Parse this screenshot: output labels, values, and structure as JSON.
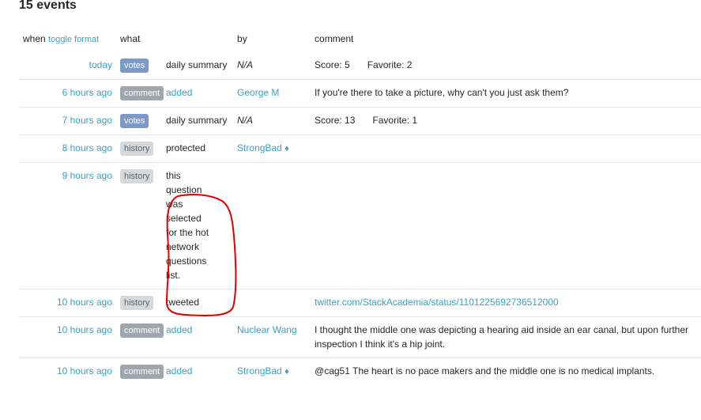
{
  "header": {
    "title": "15 events"
  },
  "columns": {
    "when": "when",
    "toggle_format": "toggle format",
    "what": "what",
    "by": "by",
    "comment": "comment"
  },
  "annotation": {
    "type": "red-freehand-circle",
    "color": "#e00000",
    "target": "row 5 what"
  },
  "rows": [
    {
      "when": "today",
      "badge": "votes",
      "what": "daily summary",
      "what_link": false,
      "by": "N/A",
      "by_link": false,
      "by_mod": false,
      "score_label": "Score: 5",
      "favorite_label": "Favorite: 2",
      "comment": ""
    },
    {
      "when": "6 hours ago",
      "badge": "comment",
      "what": "added",
      "what_link": true,
      "by": "George M",
      "by_link": true,
      "by_mod": false,
      "comment": "If you're there to take a picture, why can't you just ask them?"
    },
    {
      "when": "7 hours ago",
      "badge": "votes",
      "what": "daily summary",
      "what_link": false,
      "by": "N/A",
      "by_link": false,
      "by_mod": false,
      "score_label": "Score: 13",
      "favorite_label": "Favorite: 1",
      "comment": ""
    },
    {
      "when": "8 hours ago",
      "badge": "history",
      "what": "protected",
      "what_link": false,
      "by": "StrongBad",
      "by_link": true,
      "by_mod": true,
      "comment": ""
    },
    {
      "when": "9 hours ago",
      "badge": "history",
      "what": "this question was selected for the hot network questions list.",
      "what_link": false,
      "by": "",
      "by_link": false,
      "by_mod": false,
      "comment": ""
    },
    {
      "when": "10 hours ago",
      "badge": "history",
      "what": "tweeted",
      "what_link": false,
      "by": "",
      "by_link": false,
      "by_mod": false,
      "comment_link": "twitter.com/StackAcademia/status/1101225692736512000",
      "comment": ""
    },
    {
      "when": "10 hours ago",
      "badge": "comment",
      "what": "added",
      "what_link": true,
      "by": "Nuclear Wang",
      "by_link": true,
      "by_mod": false,
      "comment": "I thought the middle one was depicting a hearing aid inside an ear canal, but upon further inspection I think it's a hip joint."
    },
    {
      "when": "10 hours ago",
      "badge": "comment",
      "what": "added",
      "what_link": true,
      "by": "StrongBad",
      "by_link": true,
      "by_mod": true,
      "comment": "@cag51 The heart is no pace makers and the middle one is no medical implants."
    }
  ],
  "mod_diamond": "♦"
}
